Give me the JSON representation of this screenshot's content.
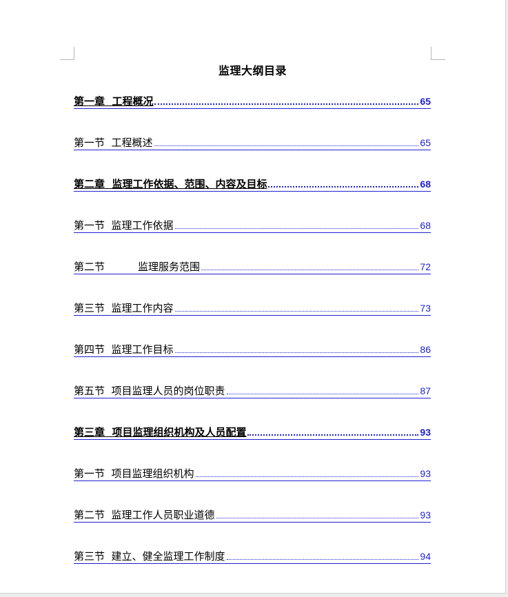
{
  "document": {
    "title": "监理大纲目录"
  },
  "toc": [
    {
      "level": "chapter",
      "label": "第一章  工程概况",
      "page": "65"
    },
    {
      "level": "section",
      "label": "第一节  工程概述",
      "page": "65"
    },
    {
      "level": "chapter",
      "label": "第二章  监理工作依据、范围、内容及目标",
      "page": "68"
    },
    {
      "level": "section",
      "label": "第一节  监理工作依据",
      "page": "68"
    },
    {
      "level": "section",
      "label": "第二节",
      "label_after_gap": "监理服务范围",
      "page": "72"
    },
    {
      "level": "section",
      "label": "第三节  监理工作内容",
      "page": "73"
    },
    {
      "level": "section",
      "label": "第四节  监理工作目标",
      "page": "86"
    },
    {
      "level": "section",
      "label": "第五节  项目监理人员的岗位职责",
      "page": "87"
    },
    {
      "level": "chapter",
      "label": "第三章  项目监理组织机构及人员配置",
      "page": "93"
    },
    {
      "level": "section",
      "label": "第一节  项目监理组织机构",
      "page": "93"
    },
    {
      "level": "section",
      "label": "第二节  监理工作人员职业道德",
      "page": "93"
    },
    {
      "level": "section",
      "label": "第三节  建立、健全监理工作制度",
      "page": "94"
    }
  ],
  "colors": {
    "link": "#1f1fd0",
    "text": "#000000",
    "page_background": "#ffffff"
  }
}
